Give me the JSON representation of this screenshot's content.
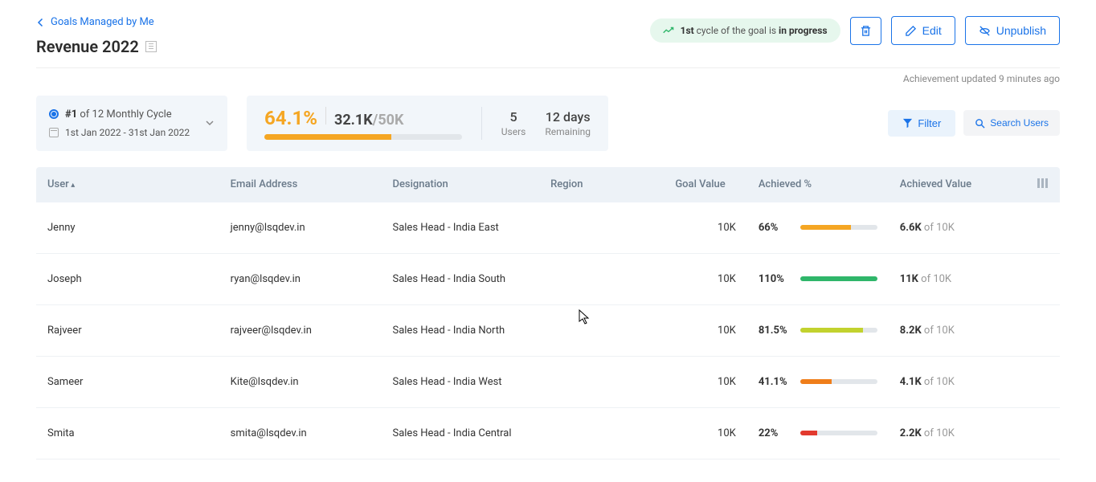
{
  "breadcrumb": {
    "back_label": "Goals Managed by Me"
  },
  "title": "Revenue 2022",
  "status_pill": {
    "prefix": "",
    "cycle_bold": "1st",
    "mid": " cycle of the goal is ",
    "state": "in progress"
  },
  "actions": {
    "edit": "Edit",
    "unpublish": "Unpublish"
  },
  "meta": {
    "updated": "Achievement updated 9 minutes ago"
  },
  "cycle": {
    "number_bold": "#1",
    "of_text": " of 12 Monthly Cycle",
    "date_range": "1st Jan 2022 - 31st Jan 2022"
  },
  "progress": {
    "percent_label": "64.1%",
    "percent": 64.1,
    "achieved": "32.1K",
    "sep": "/",
    "total": "50K",
    "users_value": "5",
    "users_label": "Users",
    "remaining_value": "12 days",
    "remaining_label": "Remaining"
  },
  "filter": {
    "filter_label": "Filter",
    "search_label": "Search Users"
  },
  "table": {
    "headers": {
      "user": "User",
      "email": "Email Address",
      "designation": "Designation",
      "region": "Region",
      "goal_value": "Goal Value",
      "achieved_pct": "Achieved %",
      "achieved_value": "Achieved Value"
    },
    "of_text": " of ",
    "rows": [
      {
        "user": "Jenny",
        "email": "jenny@lsqdev.in",
        "designation": "Sales Head - India East",
        "region": "",
        "goal": "10K",
        "pct_label": "66%",
        "pct": 66,
        "fill_color": "#f5a623",
        "ach_bold": "6.6K",
        "ach_total": "10K"
      },
      {
        "user": "Joseph",
        "email": "ryan@lsqdev.in",
        "designation": "Sales Head - India South",
        "region": "",
        "goal": "10K",
        "pct_label": "110%",
        "pct": 100,
        "fill_color": "#2fb66a",
        "ach_bold": "11K",
        "ach_total": "10K"
      },
      {
        "user": "Rajveer",
        "email": "rajveer@lsqdev.in",
        "designation": "Sales Head - India North",
        "region": "",
        "goal": "10K",
        "pct_label": "81.5%",
        "pct": 81.5,
        "fill_color": "#c2d22e",
        "ach_bold": "8.2K",
        "ach_total": "10K"
      },
      {
        "user": "Sameer",
        "email": "Kite@lsqdev.in",
        "designation": "Sales Head - India West",
        "region": "",
        "goal": "10K",
        "pct_label": "41.1%",
        "pct": 41.1,
        "fill_color": "#ef7e1a",
        "ach_bold": "4.1K",
        "ach_total": "10K"
      },
      {
        "user": "Smita",
        "email": "smita@lsqdev.in",
        "designation": "Sales Head - India Central",
        "region": "",
        "goal": "10K",
        "pct_label": "22%",
        "pct": 22,
        "fill_color": "#e23a2e",
        "ach_bold": "2.2K",
        "ach_total": "10K"
      }
    ]
  }
}
